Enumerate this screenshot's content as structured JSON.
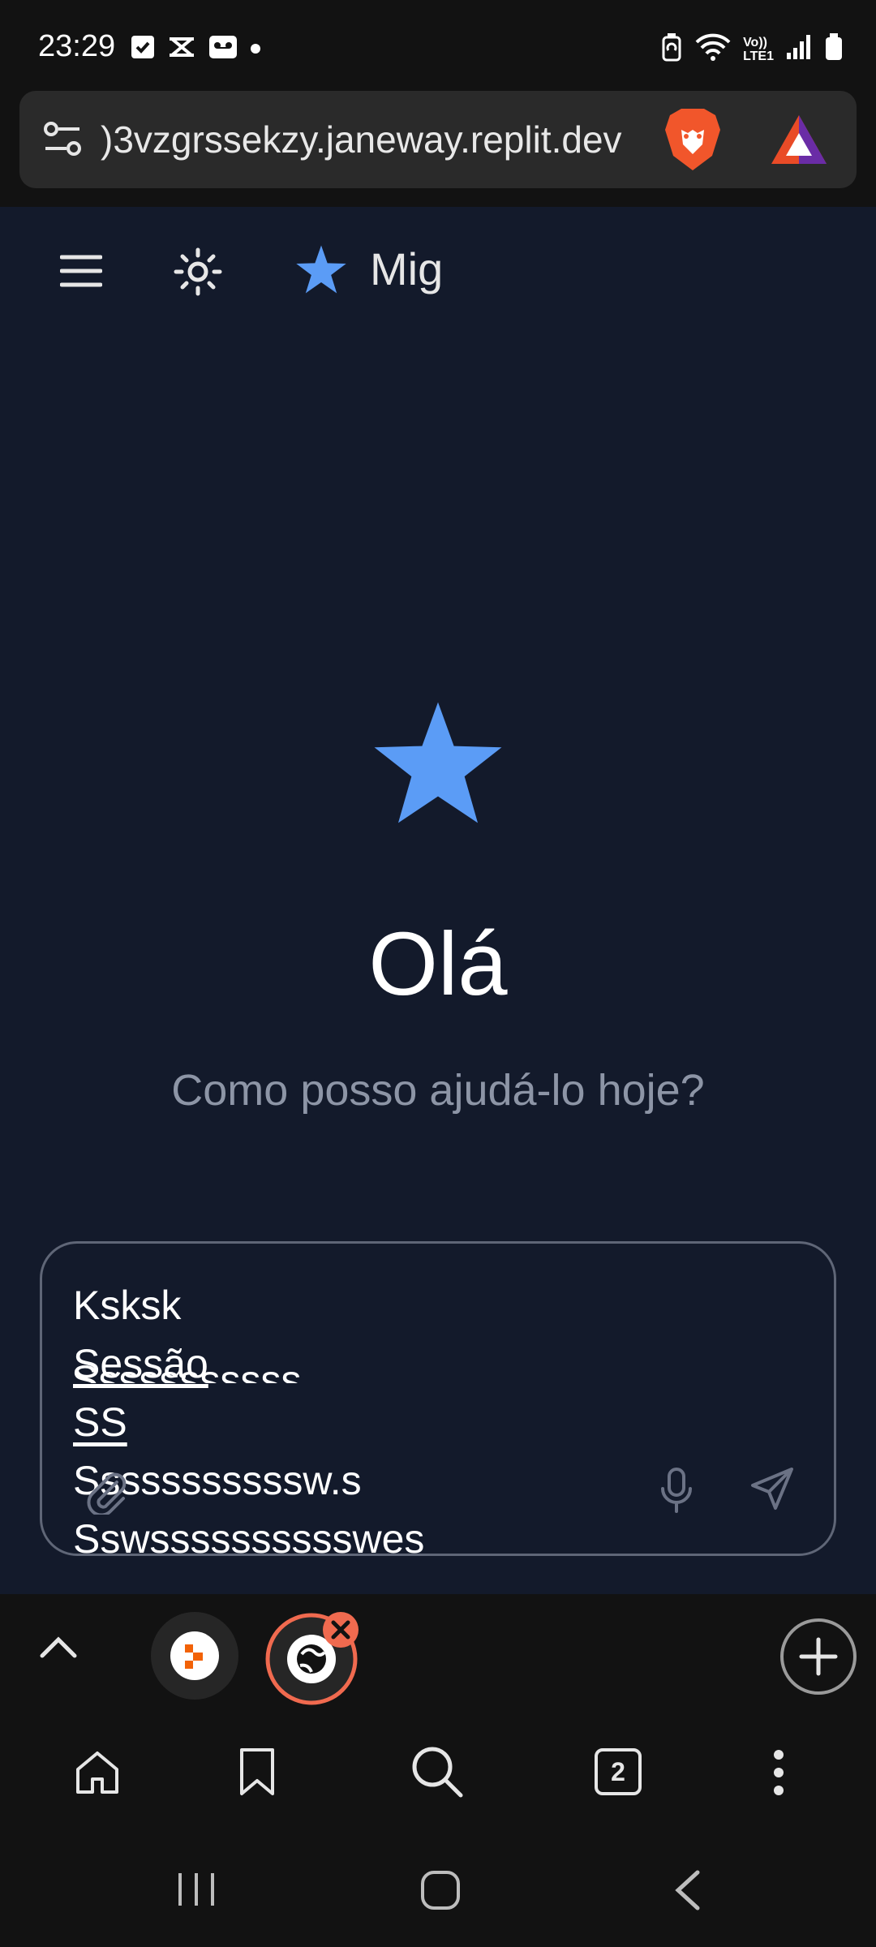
{
  "status_bar": {
    "time": "23:29",
    "left_icons": [
      "checkbox-notification-icon",
      "capcut-icon",
      "voicemail-icon",
      "dot-icon"
    ],
    "right_icons": [
      "battery-saver-icon",
      "wifi-icon",
      "volte-icon",
      "signal-icon",
      "battery-icon"
    ],
    "volte_label_top": "Vo))",
    "volte_label_bottom": "LTE1"
  },
  "browser": {
    "url": ")3vzgrssekzy.janeway.replit.dev",
    "tabs_count": "2"
  },
  "app": {
    "title": "Mig",
    "greeting": "Olá",
    "subtitle": "Como posso ajudá-lo hoje?",
    "input_lines": [
      "Ksksk",
      "Sessão",
      "SS",
      "Sssssssssssw.s",
      "Sswsssssssssswes",
      "Sssssssssss"
    ]
  },
  "colors": {
    "accent": "#5b9cf6",
    "app_bg": "#131a2b",
    "browser_bg": "#121212",
    "muted_text": "#8d95a6",
    "tab_close": "#f06a4f"
  }
}
